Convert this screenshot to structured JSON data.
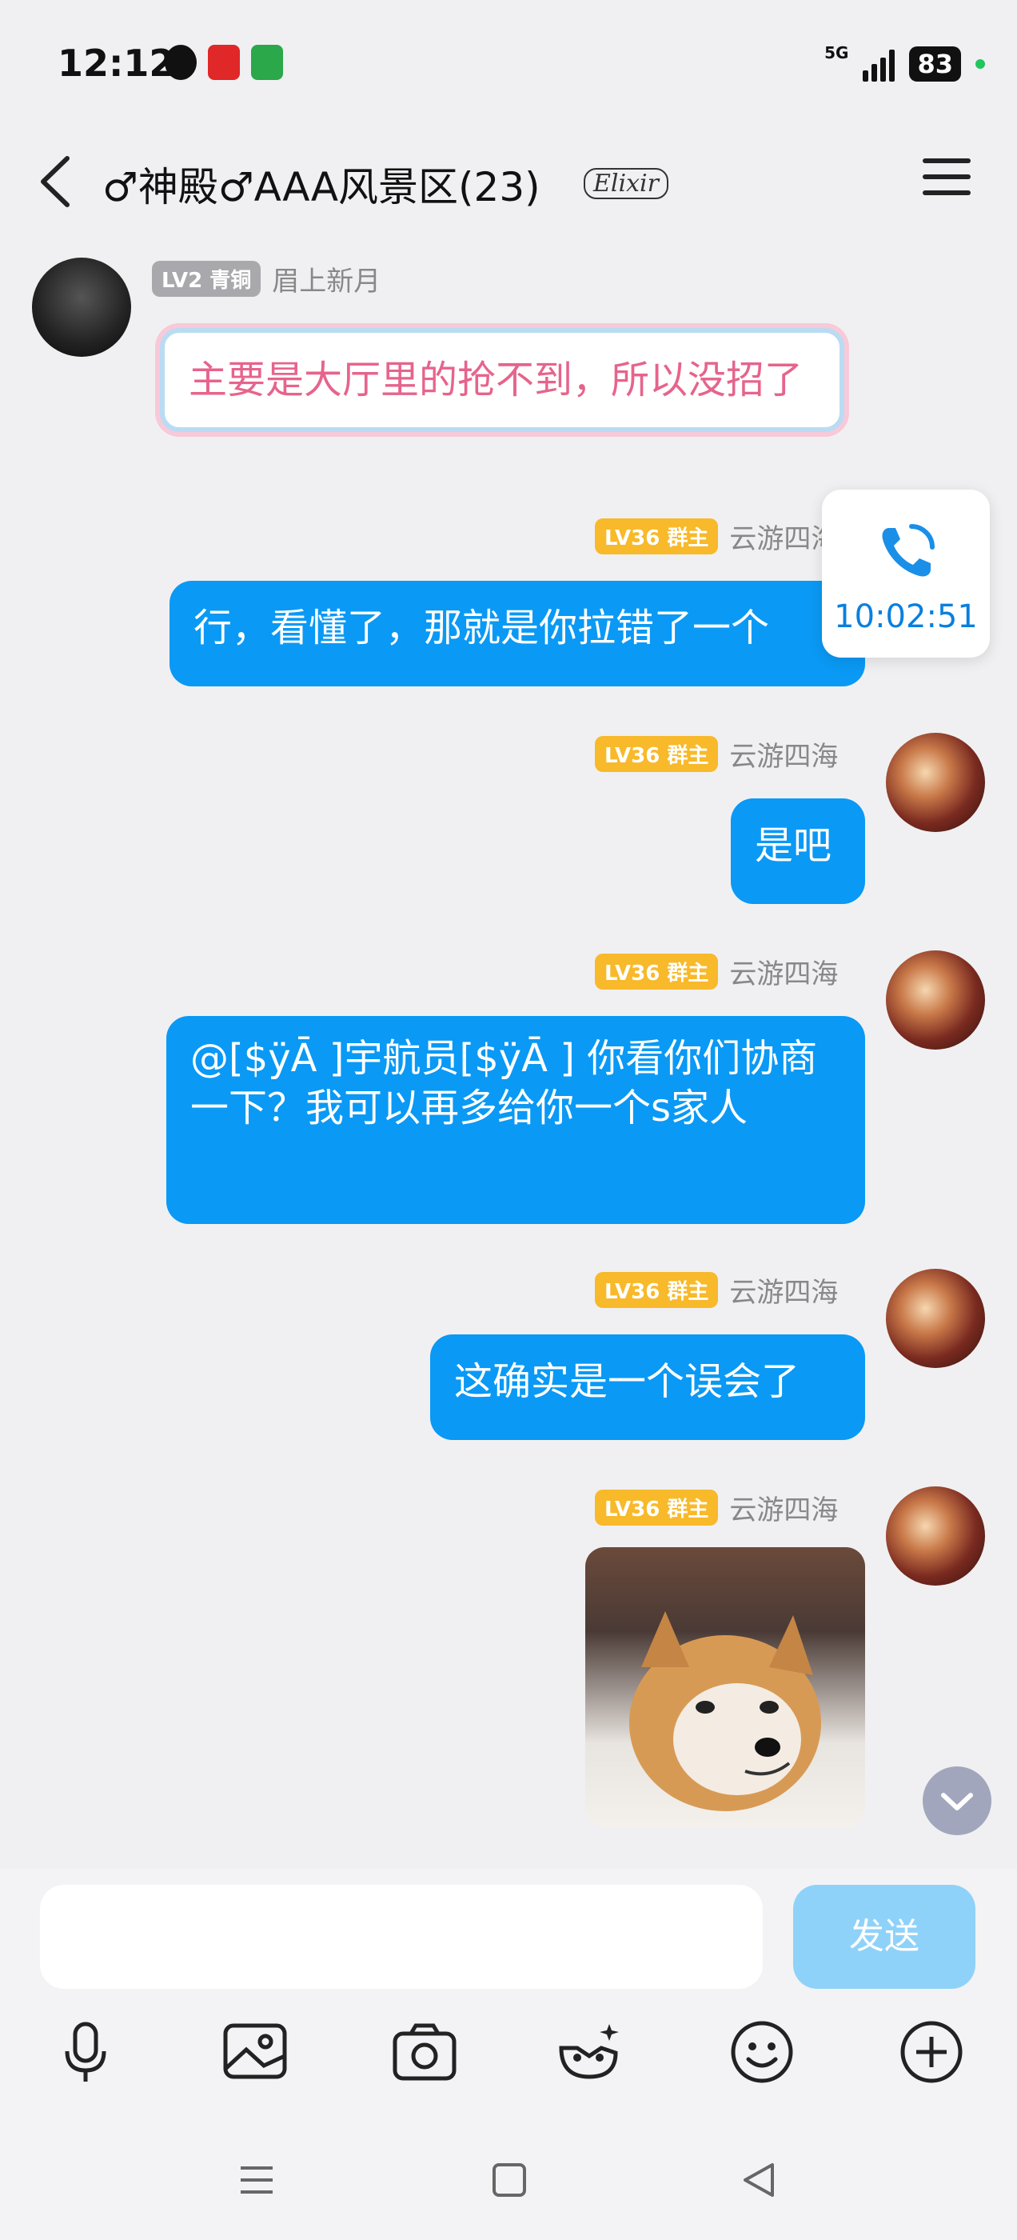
{
  "status_bar": {
    "time": "12:12",
    "network": "5G",
    "battery": "83"
  },
  "header": {
    "title": "♂神殿♂AAA风景区(23)",
    "badge": "Elixir"
  },
  "messages": [
    {
      "sender": "眉上新月",
      "level": "LV2 青铜",
      "text": "主要是大厅里的抢不到，所以没招了"
    },
    {
      "sender": "云游四海",
      "level": "LV36 群主",
      "text": "行，看懂了，那就是你拉错了一个"
    },
    {
      "sender": "云游四海",
      "level": "LV36 群主",
      "text": "是吧"
    },
    {
      "sender": "云游四海",
      "level": "LV36 群主",
      "text": "@[$ÿĀ ]宇航员[$ÿĀ ] 你看你们协商一下？我可以再多给你一个s家人"
    },
    {
      "sender": "云游四海",
      "level": "LV36 群主",
      "text": "这确实是一个误会了"
    },
    {
      "sender": "云游四海",
      "level": "LV36 群主",
      "text": ""
    }
  ],
  "call_card": {
    "time": "10:02:51"
  },
  "composer": {
    "input_value": "",
    "send_label": "发送"
  },
  "colors": {
    "bubble_blue": "#0a99f5",
    "owner_badge": "#f8b92a",
    "send_disabled": "#8fd2f9"
  }
}
